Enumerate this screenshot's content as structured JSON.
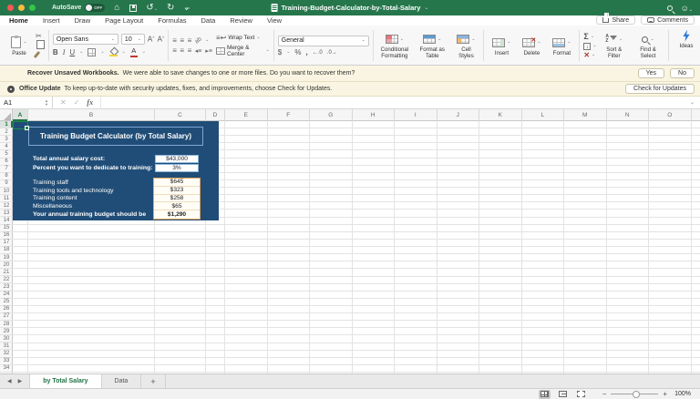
{
  "titlebar": {
    "autosave_label": "AutoSave",
    "autosave_state": "OFF",
    "document_title": "Training-Budget-Calculator-by-Total-Salary"
  },
  "menu_tabs": {
    "items": [
      "Home",
      "Insert",
      "Draw",
      "Page Layout",
      "Formulas",
      "Data",
      "Review",
      "View"
    ],
    "active": "Home"
  },
  "actions": {
    "share": "Share",
    "comments": "Comments"
  },
  "ribbon": {
    "paste": "Paste",
    "font_name": "Open Sans",
    "font_size": "10",
    "wrap_text": "Wrap Text",
    "merge_center": "Merge & Center",
    "number_format": "General",
    "conditional_formatting": "Conditional Formatting",
    "format_as_table": "Format as Table",
    "cell_styles": "Cell Styles",
    "insert": "Insert",
    "delete": "Delete",
    "format": "Format",
    "sort_filter": "Sort & Filter",
    "find_select": "Find & Select",
    "ideas": "Ideas"
  },
  "notifications": [
    {
      "title": "Recover Unsaved Workbooks.",
      "message": "We were able to save changes to one or more files. Do you want to recover them?",
      "buttons": [
        "Yes",
        "No"
      ]
    },
    {
      "title": "Office Update",
      "message": "To keep up-to-date with security updates, fixes, and improvements, choose Check for Updates.",
      "buttons": [
        "Check for Updates"
      ]
    }
  ],
  "formula_bar": {
    "name_box": "A1",
    "fx_label": "fx"
  },
  "grid": {
    "columns": [
      "A",
      "B",
      "C",
      "D",
      "E",
      "F",
      "G",
      "H",
      "I",
      "J",
      "K",
      "L",
      "M",
      "N",
      "O"
    ],
    "row_count": 34,
    "selected_cell": "A1"
  },
  "calculator": {
    "title": "Training Budget Calculator (by Total Salary)",
    "inputs": [
      {
        "label": "Total annual salary cost:",
        "value": "$43,000"
      },
      {
        "label": "Percent you want to dedicate to training:",
        "value": "3%"
      }
    ],
    "outputs": [
      {
        "label": "Training staff",
        "value": "$645",
        "bold": false
      },
      {
        "label": "Training tools and technology",
        "value": "$323",
        "bold": false
      },
      {
        "label": "Training content",
        "value": "$258",
        "bold": false
      },
      {
        "label": "Miscellaneous",
        "value": "$65",
        "bold": false
      },
      {
        "label": "Your annual training budget should be",
        "value": "$1,290",
        "bold": true
      }
    ]
  },
  "sheet_tabs": {
    "tabs": [
      {
        "label": "by Total Salary",
        "active": true
      },
      {
        "label": "Data",
        "active": false
      }
    ],
    "add_label": "+"
  },
  "status_bar": {
    "zoom": "100%"
  },
  "colors": {
    "titlebar_green": "#26764C",
    "accent_green": "#217346",
    "calculator_navy": "#204D77",
    "input_border_blue": "#8FB8DC",
    "output_border_orange": "#E2A558",
    "notice_background": "#FAF5E2",
    "ideas_blue": "#2E7CD6"
  }
}
